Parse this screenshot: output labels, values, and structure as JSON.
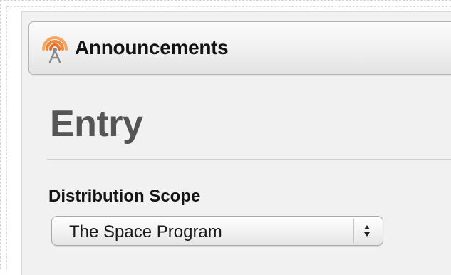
{
  "header": {
    "title": "Announcements",
    "icon": "broadcast-tower-icon"
  },
  "main": {
    "page_title": "Entry",
    "distribution_scope": {
      "label": "Distribution Scope",
      "selected": "The Space Program"
    }
  },
  "colors": {
    "icon_accent": "#f08a3a",
    "heading": "#555555",
    "label": "#141414"
  }
}
